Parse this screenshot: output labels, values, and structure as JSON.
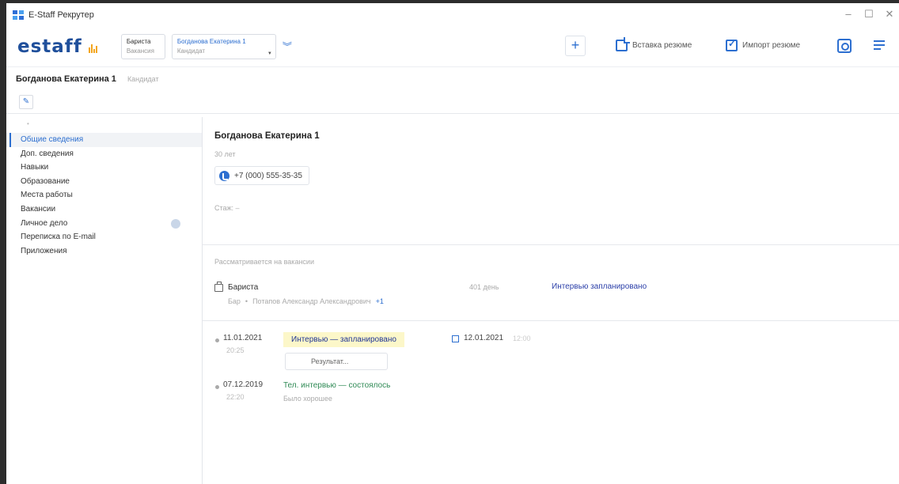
{
  "window": {
    "title": "E-Staff Рекрутер",
    "controls": [
      "–",
      "☐",
      "✕"
    ]
  },
  "toolbar": {
    "logo_text": "estaff",
    "context1": {
      "title": "Бариста",
      "subtitle": "Вакансия"
    },
    "context2": {
      "title": "Богданова Екатерина 1",
      "subtitle": "Кандидат"
    },
    "add_label": "+",
    "insert_resume_label": "Вставка резюме",
    "import_resume_label": "Импорт резюме"
  },
  "header": {
    "name": "Богданова Екатерина 1",
    "role": "Кандидат"
  },
  "sidebar": {
    "items": [
      {
        "label": "Общие сведения",
        "active": true
      },
      {
        "label": "Доп. сведения"
      },
      {
        "label": "Навыки"
      },
      {
        "label": "Образование"
      },
      {
        "label": "Места работы"
      },
      {
        "label": "Вакансии"
      },
      {
        "label": "Личное дело"
      },
      {
        "label": "Переписка по E-mail"
      },
      {
        "label": "Приложения"
      }
    ]
  },
  "candidate": {
    "name": "Богданова Екатерина 1",
    "age": "30 лет",
    "phone": "+7 (000) 555-35-35",
    "experience": "Стаж: –"
  },
  "vacancies": {
    "section_label": "Рассматривается на вакансии",
    "item": {
      "title": "Бариста",
      "days": "401 день",
      "status": "Интервью запланировано",
      "location": "Бар",
      "recruiter": "Потапов Александр Александрович",
      "more": "+1"
    }
  },
  "events": [
    {
      "date": "11.01.2021",
      "time": "20:25",
      "tag": "Интервью — запланировано",
      "result_label": "Результат...",
      "planned_date": "12.01.2021",
      "planned_time": "12:00"
    },
    {
      "date": "07.12.2019",
      "time": "22:20",
      "status": "Тел. интервью — состоялось",
      "note": "Было хорошее"
    }
  ],
  "colors": {
    "accent": "#2d6fd0",
    "brand": "#1f4f9b",
    "logo_bars": "#f3a51c",
    "tag_bg": "#fcf7c9",
    "status_green": "#2f8a55",
    "status_blue": "#2b3fa8"
  }
}
